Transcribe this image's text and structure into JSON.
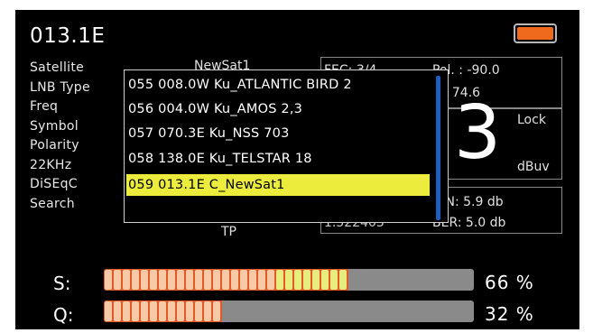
{
  "header": {
    "title": "013.1E"
  },
  "battery": {
    "color": "#f06a1d"
  },
  "labels": [
    "Satellite",
    "LNB Type",
    "Freq",
    "Symbol",
    "Polarity",
    "22KHz",
    "DiSEqC",
    "Search"
  ],
  "background_values": {
    "satellite": "NewSat1",
    "fec": "FEC: 3/4",
    "pol": "Pol. : -90.0",
    "el": "El:  74.6",
    "search": "TP",
    "freq_partial": "1.522403",
    "cn": "C/N:   5.9 db",
    "ber": "BER:  5.0 db"
  },
  "lock_panel": {
    "digit": "3",
    "lock_label": "Lock",
    "unit": "dBuv"
  },
  "satellite_list": {
    "items": [
      "055 008.0W Ku_ATLANTIC BIRD 2",
      "056 004.0W Ku_AMOS 2,3",
      "057 070.3E Ku_NSS 703",
      "058 138.0E Ku_TELSTAR 18",
      "059 013.1E C_NewSat1"
    ],
    "selected_index": 4,
    "selection_color": "#ecec3c",
    "scrollbar_color": "#1d5fc0"
  },
  "meters": [
    {
      "label": "S:",
      "percent_text": "66 %",
      "level": 0.66,
      "colors": [
        "#f7c9a6",
        "#e7ec7c"
      ]
    },
    {
      "label": "Q:",
      "percent_text": "32 %",
      "level": 0.32,
      "colors": [
        "#f7c9a6",
        "#f5e39a"
      ]
    }
  ]
}
